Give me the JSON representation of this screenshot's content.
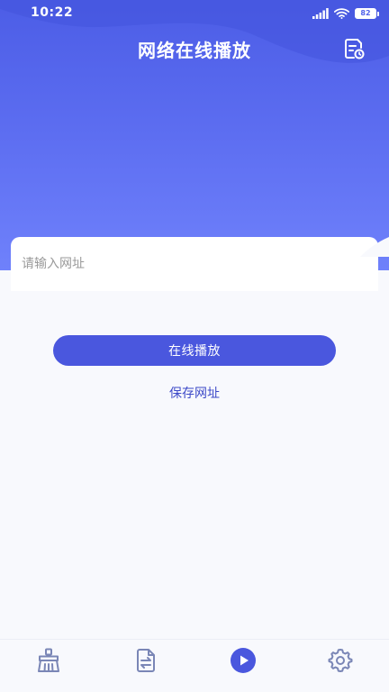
{
  "status_bar": {
    "time": "10:22",
    "battery_level": "82",
    "icons": [
      "signal-icon",
      "wifi-icon",
      "battery-icon"
    ]
  },
  "header": {
    "title": "网络在线播放",
    "right_icon": "history-document-icon"
  },
  "form": {
    "url_placeholder": "请输入网址",
    "url_value": "",
    "play_button_label": "在线播放",
    "save_link_label": "保存网址"
  },
  "bottom_nav": {
    "items": [
      {
        "icon": "broom-clean-icon",
        "active": false
      },
      {
        "icon": "file-transfer-icon",
        "active": false
      },
      {
        "icon": "play-circle-icon",
        "active": true
      },
      {
        "icon": "settings-gear-icon",
        "active": false
      }
    ]
  },
  "colors": {
    "accent": "#4a57de",
    "header_gradient_top": "#4c5de6",
    "header_gradient_bottom": "#6f81fb",
    "nav_icon": "#7a86b6",
    "background": "#f8f9fd"
  }
}
